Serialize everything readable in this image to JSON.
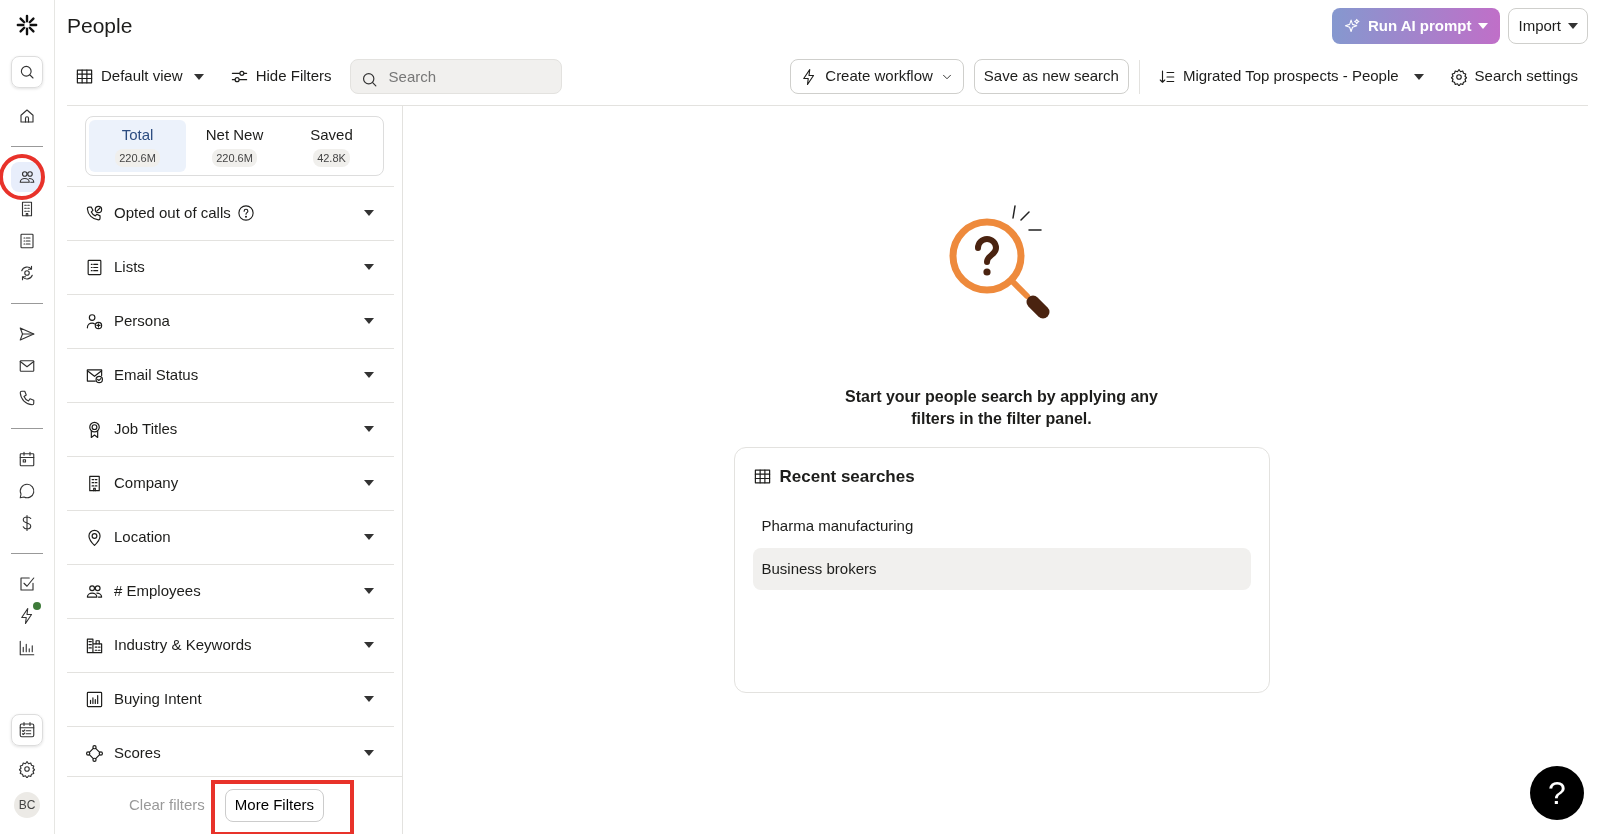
{
  "page_title": "People",
  "sidebar": {
    "items": [
      {
        "kind": "search",
        "selected": false,
        "boxed": true
      },
      {
        "kind": "home",
        "selected": false
      },
      {
        "kind": "people",
        "selected": true,
        "annotated": true,
        "divider_before": true
      },
      {
        "kind": "building",
        "selected": false
      },
      {
        "kind": "list",
        "selected": false
      },
      {
        "kind": "sync",
        "selected": false
      },
      {
        "kind": "send",
        "selected": false,
        "divider_before": true
      },
      {
        "kind": "mail",
        "selected": false
      },
      {
        "kind": "phone",
        "selected": false
      },
      {
        "kind": "calendar",
        "selected": false,
        "divider_before": true
      },
      {
        "kind": "chat",
        "selected": false
      },
      {
        "kind": "dollar",
        "selected": false
      },
      {
        "kind": "check",
        "selected": false,
        "divider_before": true
      },
      {
        "kind": "bolt",
        "selected": false,
        "notification": true
      },
      {
        "kind": "chart",
        "selected": false
      }
    ],
    "bottom": [
      {
        "kind": "tasks",
        "boxed": true
      },
      {
        "kind": "gear"
      }
    ],
    "avatar": "BC"
  },
  "header_buttons": [
    {
      "label": "Run AI prompt",
      "kind": "gradient"
    },
    {
      "label": "Import",
      "kind": "outline"
    }
  ],
  "toolbar": {
    "view": "Default view",
    "hide_filters": "Hide Filters",
    "search": {
      "placeholder": "Search"
    },
    "create_workflow": "Create workflow",
    "save_search": "Save as new search",
    "saved_search": "Migrated Top prospects - People",
    "settings": "Search settings"
  },
  "counts": [
    {
      "label": "Total",
      "count": "220.6M",
      "selected": true
    },
    {
      "label": "Net New",
      "count": "220.6M",
      "selected": false
    },
    {
      "label": "Saved",
      "count": "42.8K",
      "selected": false
    }
  ],
  "filters": [
    {
      "label": "Opted out of calls",
      "kind": "phone-block",
      "help": true
    },
    {
      "label": "Lists",
      "kind": "list"
    },
    {
      "label": "Persona",
      "kind": "persona"
    },
    {
      "label": "Email Status",
      "kind": "mail-check"
    },
    {
      "label": "Job Titles",
      "kind": "award"
    },
    {
      "label": "Company",
      "kind": "building"
    },
    {
      "label": "Location",
      "kind": "pin"
    },
    {
      "label": "# Employees",
      "kind": "people"
    },
    {
      "label": "Industry & Keywords",
      "kind": "factory"
    },
    {
      "label": "Buying Intent",
      "kind": "bars"
    },
    {
      "label": "Scores",
      "kind": "nodes"
    }
  ],
  "footer": {
    "clear": {
      "label": "Clear filters",
      "disabled": true
    },
    "more": {
      "label": "More Filters",
      "annotated": true
    }
  },
  "empty_state": {
    "message": "Start your people search by applying any filters in the filter panel.",
    "recent": {
      "title": "Recent searches",
      "items": [
        {
          "label": "Pharma manufacturing",
          "selected": false
        },
        {
          "label": "Business brokers",
          "selected": true
        }
      ]
    }
  },
  "help_button": "?"
}
